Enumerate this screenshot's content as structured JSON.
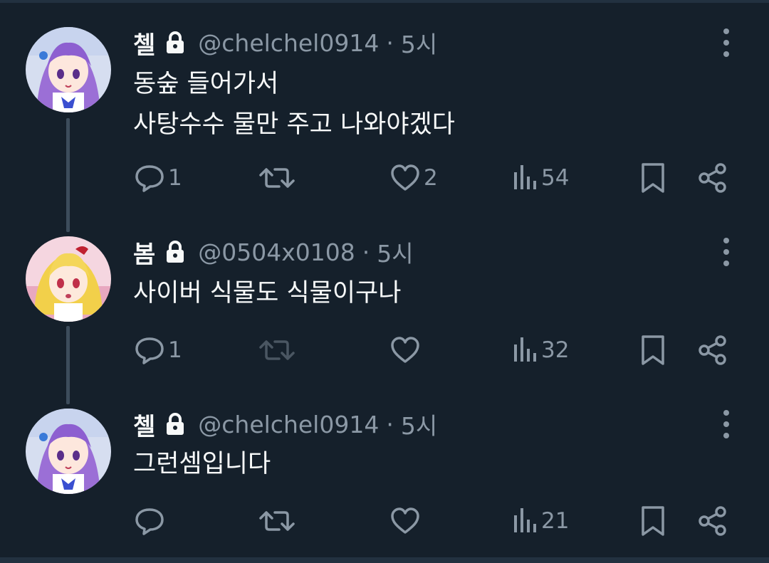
{
  "colors": {
    "background": "#15202b",
    "text": "#f7f9f9",
    "muted": "#8b98a5",
    "thread_line": "#3d4d5c"
  },
  "tweets": [
    {
      "name": "첼",
      "handle": "@chelchel0914",
      "dot": "·",
      "time": "5시",
      "lines": [
        "동숲 들어가서",
        "사탕수수 물만 주고 나와야겠다"
      ],
      "replies": "1",
      "retweets": "",
      "likes": "2",
      "views": "54",
      "retweet_disabled": false
    },
    {
      "name": "봄",
      "handle": "@0504x0108",
      "dot": "·",
      "time": "5시",
      "lines": [
        "사이버 식물도 식물이구나"
      ],
      "replies": "1",
      "retweets": "",
      "likes": "",
      "views": "32",
      "retweet_disabled": true
    },
    {
      "name": "첼",
      "handle": "@chelchel0914",
      "dot": "·",
      "time": "5시",
      "lines": [
        "그런셈입니다"
      ],
      "replies": "",
      "retweets": "",
      "likes": "",
      "views": "21",
      "retweet_disabled": false
    }
  ],
  "icons": {
    "lock": "lock-icon",
    "reply": "reply-icon",
    "retweet": "retweet-icon",
    "like": "heart-icon",
    "views": "views-chart-icon",
    "bookmark": "bookmark-icon",
    "share": "share-icon",
    "more": "more-dots-icon"
  }
}
